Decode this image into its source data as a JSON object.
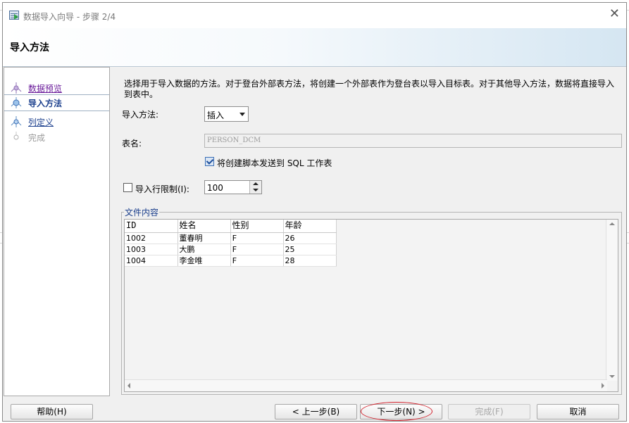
{
  "window": {
    "title": "数据导入向导 - 步骤 2/4"
  },
  "header": {
    "title": "导入方法"
  },
  "steps": [
    {
      "label": "数据预览",
      "state": "visited"
    },
    {
      "label": "导入方法",
      "state": "current"
    },
    {
      "label": "列定义",
      "state": "link"
    },
    {
      "label": "完成",
      "state": "disabled"
    }
  ],
  "main": {
    "description": "选择用于导入数据的方法。对于登台外部表方法，将创建一个外部表作为登台表以导入目标表。对于其他导入方法，数据将直接导入到表中。",
    "import_method": {
      "label": "导入方法:",
      "value": "插入"
    },
    "table_name": {
      "label": "表名:",
      "value": "PERSON_DCM"
    },
    "send_script": {
      "label": "将创建脚本发送到 SQL 工作表",
      "checked": true
    },
    "row_limit": {
      "label": "导入行限制(I):",
      "value": "100",
      "checked": false
    },
    "file_content": {
      "title": "文件内容",
      "columns": [
        "ID",
        "姓名",
        "性别",
        "年龄"
      ],
      "rows": [
        [
          "1002",
          "董春明",
          "F",
          "26"
        ],
        [
          "1003",
          "大鹏",
          "F",
          "25"
        ],
        [
          "1004",
          "李金唯",
          "F",
          "28"
        ]
      ]
    }
  },
  "buttons": {
    "help": "帮助(H)",
    "prev": "< 上一步(B)",
    "next": "下一步(N) >",
    "finish": "完成(F)",
    "cancel": "取消"
  },
  "colors": {
    "accent": "#1a3e8c",
    "visited": "#6a1b9a",
    "annotation": "#d21f2a"
  }
}
